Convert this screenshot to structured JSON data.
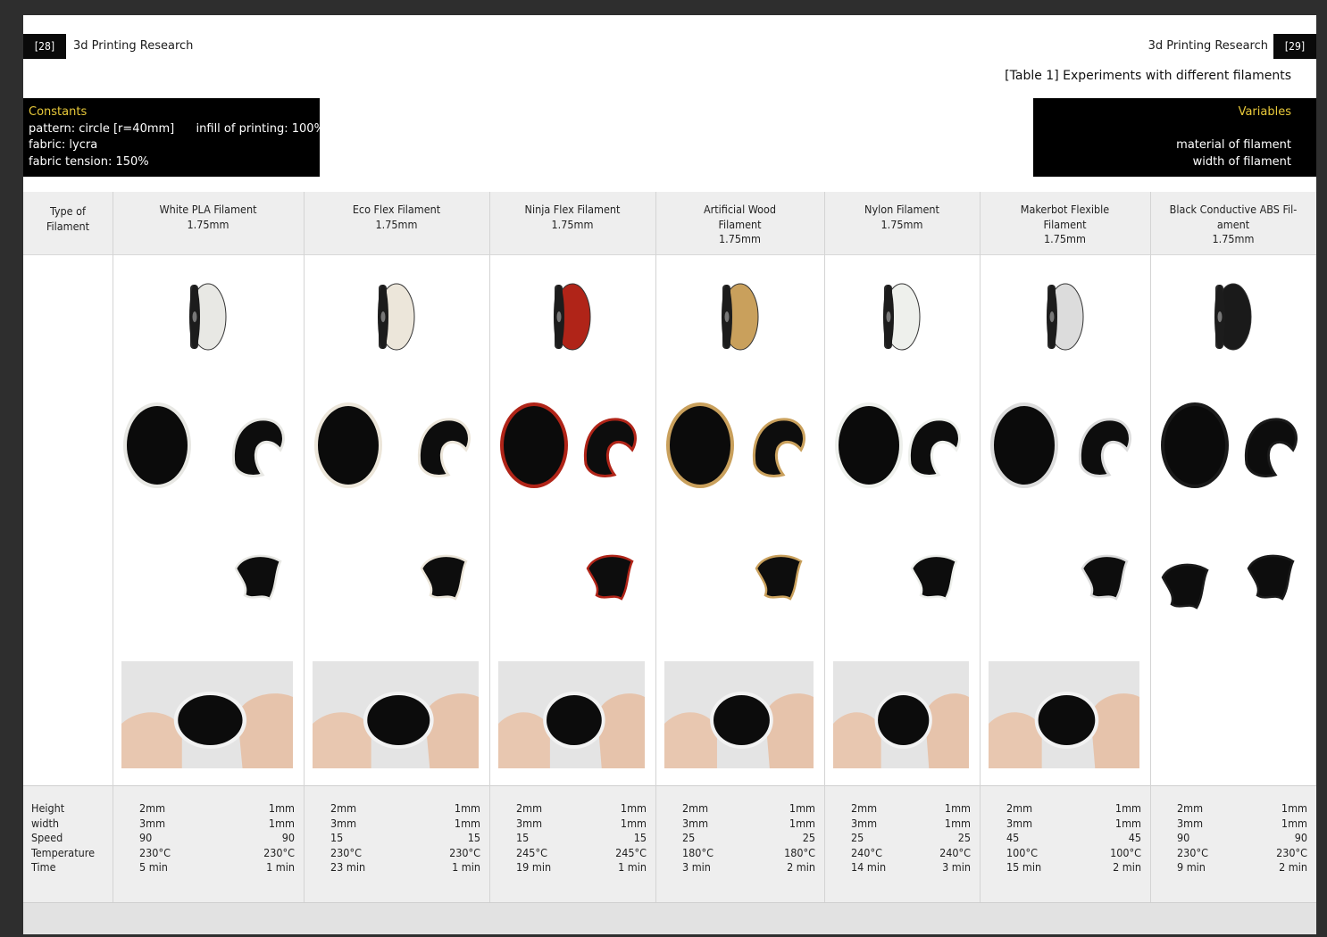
{
  "header": {
    "left_page_number": "[28]",
    "left_title": "3d Printing Research",
    "right_title": "3d Printing Research",
    "right_page_number": "[29]"
  },
  "table_caption": "[Table 1] Experiments with different filaments",
  "constants": {
    "title": "Constants",
    "pattern": "pattern: circle [r=40mm]",
    "infill": "infill of printing: 100%",
    "fabric": "fabric: lycra",
    "tension": "fabric tension: 150%"
  },
  "variables": {
    "title": "Variables",
    "items": [
      "material of filament",
      "width of filament"
    ]
  },
  "row_header": {
    "type_of_filament_line1": "Type of",
    "type_of_filament_line2": "Filament"
  },
  "param_labels": [
    "Height",
    "width",
    "Speed",
    "Temperature",
    "Time"
  ],
  "filaments": [
    {
      "name_lines": [
        "White PLA Filament",
        "1.75mm"
      ],
      "spool_color": "#e8e8e4",
      "left_values": [
        "2mm",
        "3mm",
        "90",
        "230°C",
        "5 min"
      ],
      "right_values": [
        "1mm",
        "1mm",
        "90",
        "230°C",
        "1 min"
      ]
    },
    {
      "name_lines": [
        "Eco Flex Filament",
        "1.75mm"
      ],
      "spool_color": "#ece6da",
      "left_values": [
        "2mm",
        "3mm",
        "15",
        "230°C",
        "23 min"
      ],
      "right_values": [
        "1mm",
        "1mm",
        "15",
        "230°C",
        "1 min"
      ]
    },
    {
      "name_lines": [
        "Ninja Flex Filament",
        "1.75mm"
      ],
      "spool_color": "#b02418",
      "left_values": [
        "2mm",
        "3mm",
        "15",
        "245°C",
        "19 min"
      ],
      "right_values": [
        "1mm",
        "1mm",
        "15",
        "245°C",
        "1 min"
      ]
    },
    {
      "name_lines": [
        "Artificial Wood",
        "Filament",
        "1.75mm"
      ],
      "spool_color": "#c9a05c",
      "left_values": [
        "2mm",
        "3mm",
        "25",
        "180°C",
        "3 min"
      ],
      "right_values": [
        "1mm",
        "1mm",
        "25",
        "180°C",
        "2 min"
      ]
    },
    {
      "name_lines": [
        "Nylon Filament",
        "1.75mm"
      ],
      "spool_color": "#eef0ec",
      "left_values": [
        "2mm",
        "3mm",
        "25",
        "240°C",
        "14 min"
      ],
      "right_values": [
        "1mm",
        "1mm",
        "25",
        "240°C",
        "3 min"
      ]
    },
    {
      "name_lines": [
        "Makerbot Flexible",
        "Filament",
        "1.75mm"
      ],
      "spool_color": "#dcdcdc",
      "left_values": [
        "2mm",
        "3mm",
        "45",
        "100°C",
        "15 min"
      ],
      "right_values": [
        "1mm",
        "1mm",
        "45",
        "100°C",
        "2 min"
      ]
    },
    {
      "name_lines": [
        "Black Conductive ABS Fil-",
        "ament",
        "1.75mm"
      ],
      "spool_color": "#1a1a1a",
      "left_values": [
        "2mm",
        "3mm",
        "90",
        "230°C",
        "9 min"
      ],
      "right_values": [
        "1mm",
        "1mm",
        "90",
        "230°C",
        "2 min"
      ]
    }
  ]
}
